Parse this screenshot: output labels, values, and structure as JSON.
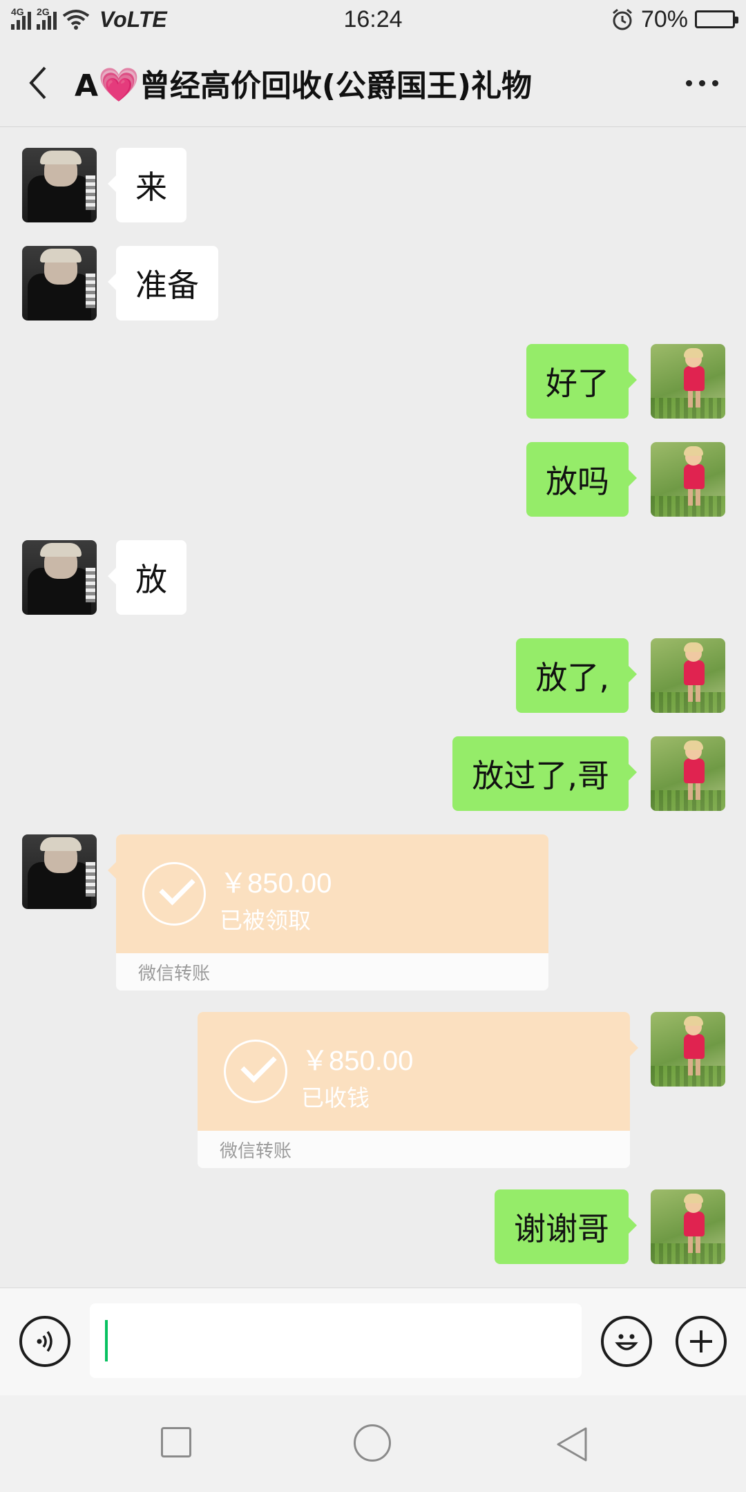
{
  "status_bar": {
    "network_1": "4G",
    "network_2": "2G",
    "volte": "VoLTE",
    "time": "16:24",
    "battery": "70%",
    "battery_level": 0.7
  },
  "header": {
    "title_prefix": "A",
    "heart_emoji": "💗",
    "title_suffix": "曾经高价回收(公爵国王)礼物"
  },
  "messages": [
    {
      "side": "in",
      "text": "来"
    },
    {
      "side": "in",
      "text": "准备"
    },
    {
      "side": "out",
      "text": "好了"
    },
    {
      "side": "out",
      "text": "放吗"
    },
    {
      "side": "in",
      "text": "放"
    },
    {
      "side": "out",
      "text": "放了,"
    },
    {
      "side": "out",
      "text": "放过了,哥"
    }
  ],
  "transfers": [
    {
      "side": "in",
      "amount": "￥850.00",
      "status": "已被领取",
      "footer": "微信转账"
    },
    {
      "side": "out",
      "amount": "￥850.00",
      "status": "已收钱",
      "footer": "微信转账"
    }
  ],
  "last_message": {
    "side": "out",
    "text": "谢谢哥"
  },
  "input": {
    "value": ""
  },
  "colors": {
    "outgoing_bubble": "#95ec69",
    "incoming_bubble": "#ffffff",
    "transfer_card": "#fbe0c0",
    "background": "#ededed",
    "caret": "#07c160"
  },
  "icons": {
    "back": "chevron-left-icon",
    "more": "more-dots-icon",
    "voice": "voice-icon",
    "emoji": "emoji-icon",
    "plus": "plus-icon",
    "nav_recent": "square-icon",
    "nav_home": "circle-icon",
    "nav_back": "triangle-icon"
  }
}
